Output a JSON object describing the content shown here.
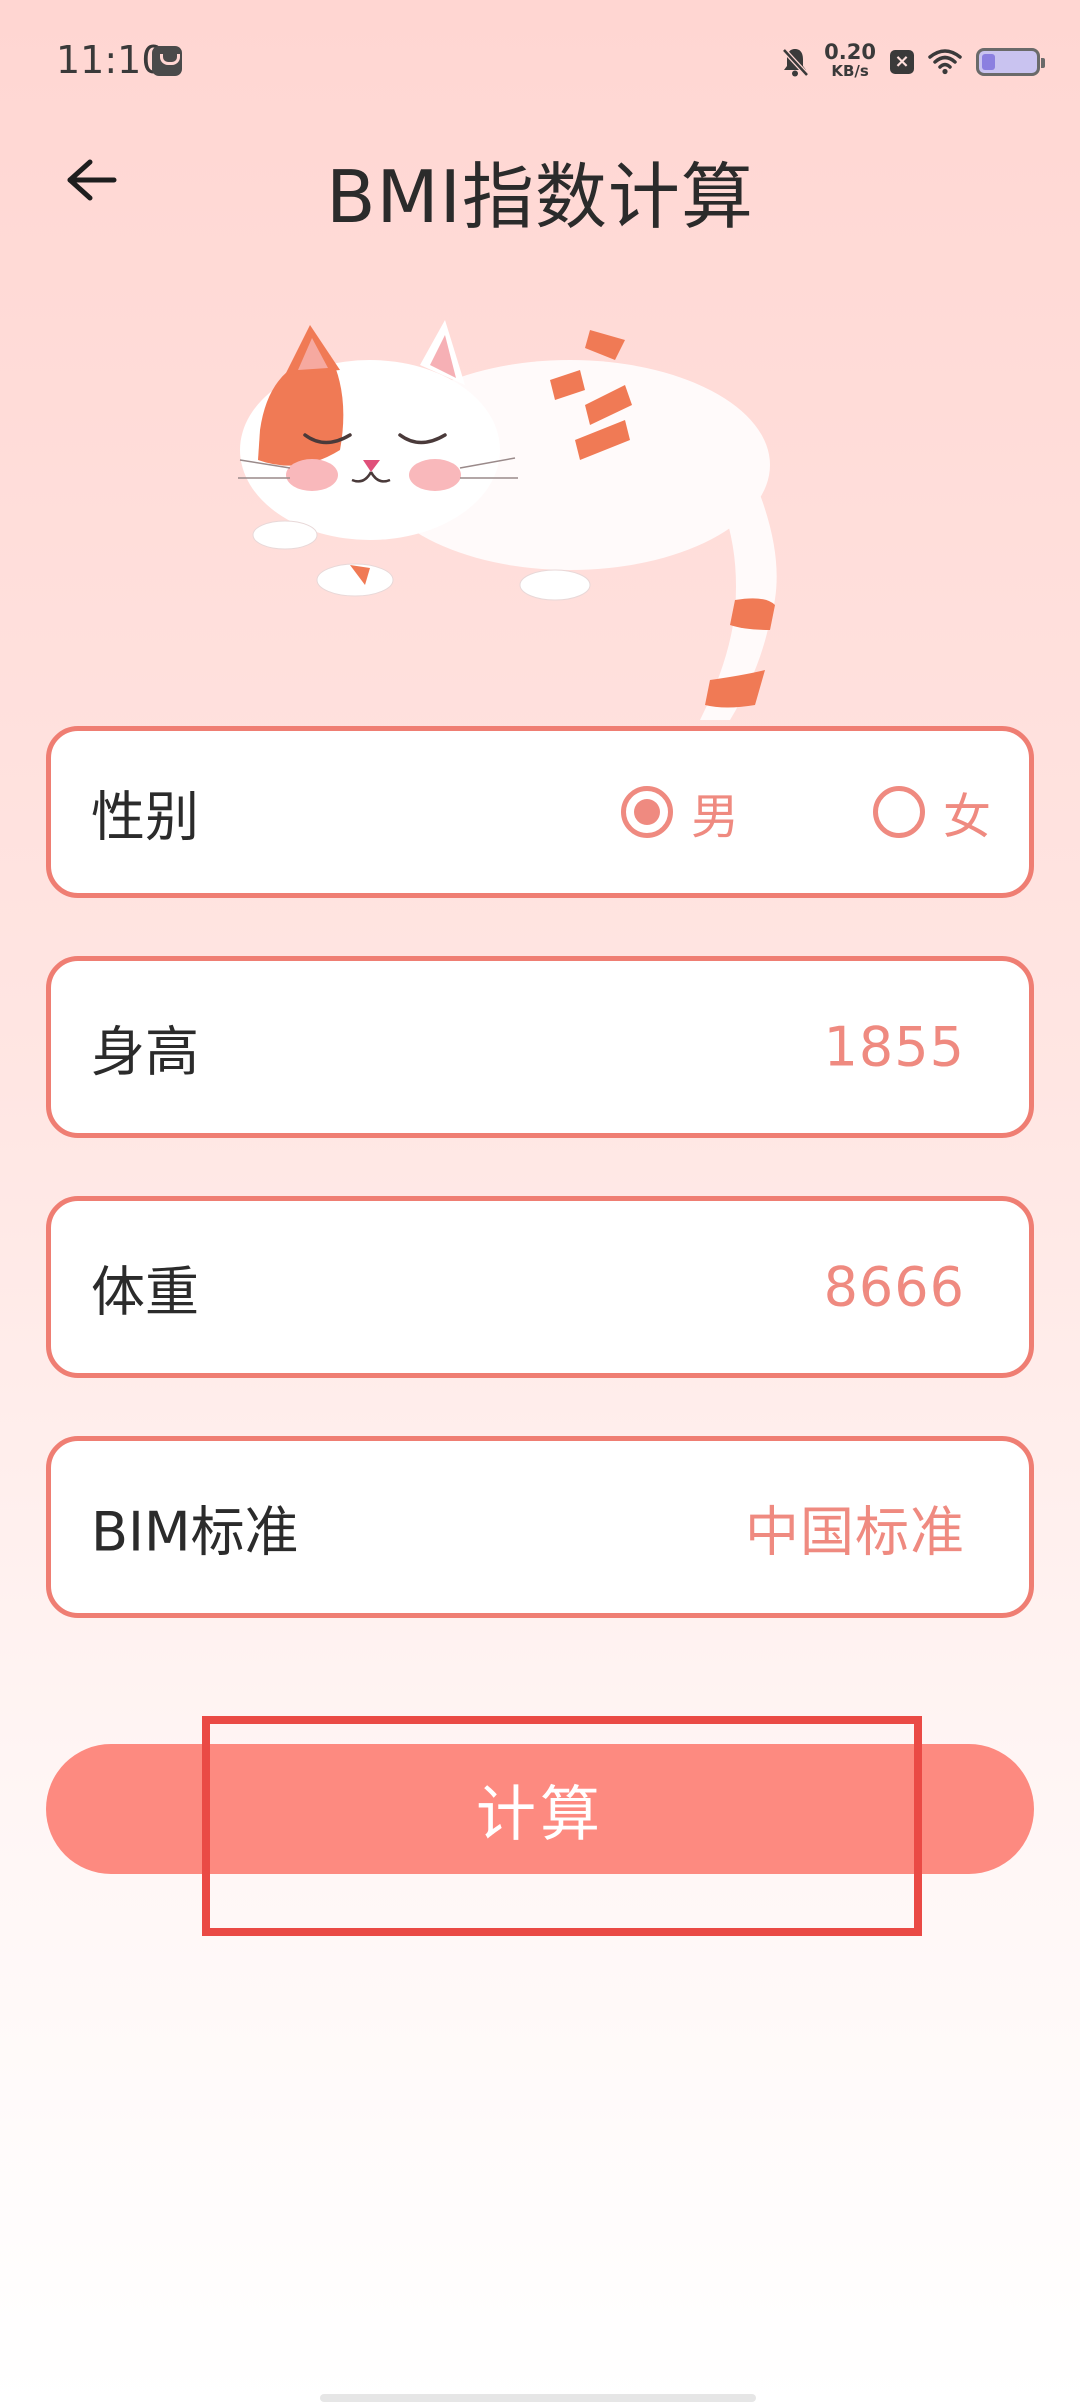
{
  "status_bar": {
    "time": "11:10",
    "net_rate": "0.20",
    "net_unit": "KB/s",
    "battery_level": 0.25,
    "icons": [
      "app-notification-icon",
      "bell-off-icon",
      "close-badge-icon",
      "wifi-icon",
      "battery-icon"
    ]
  },
  "header": {
    "title": "BMI指数计算",
    "back_icon": "arrow-left-icon"
  },
  "form": {
    "gender": {
      "label": "性别",
      "options": [
        {
          "label": "男",
          "selected": true
        },
        {
          "label": "女",
          "selected": false
        }
      ]
    },
    "height": {
      "label": "身高",
      "value": "1855"
    },
    "weight": {
      "label": "体重",
      "value": "8666"
    },
    "standard": {
      "label": "BIM标准",
      "value": "中国标准"
    }
  },
  "actions": {
    "calculate_label": "计算"
  },
  "colors": {
    "accent": "#ef7e73",
    "button": "#fd8a80",
    "highlight": "#ea4a45",
    "background_top": "#ffd6d2"
  }
}
